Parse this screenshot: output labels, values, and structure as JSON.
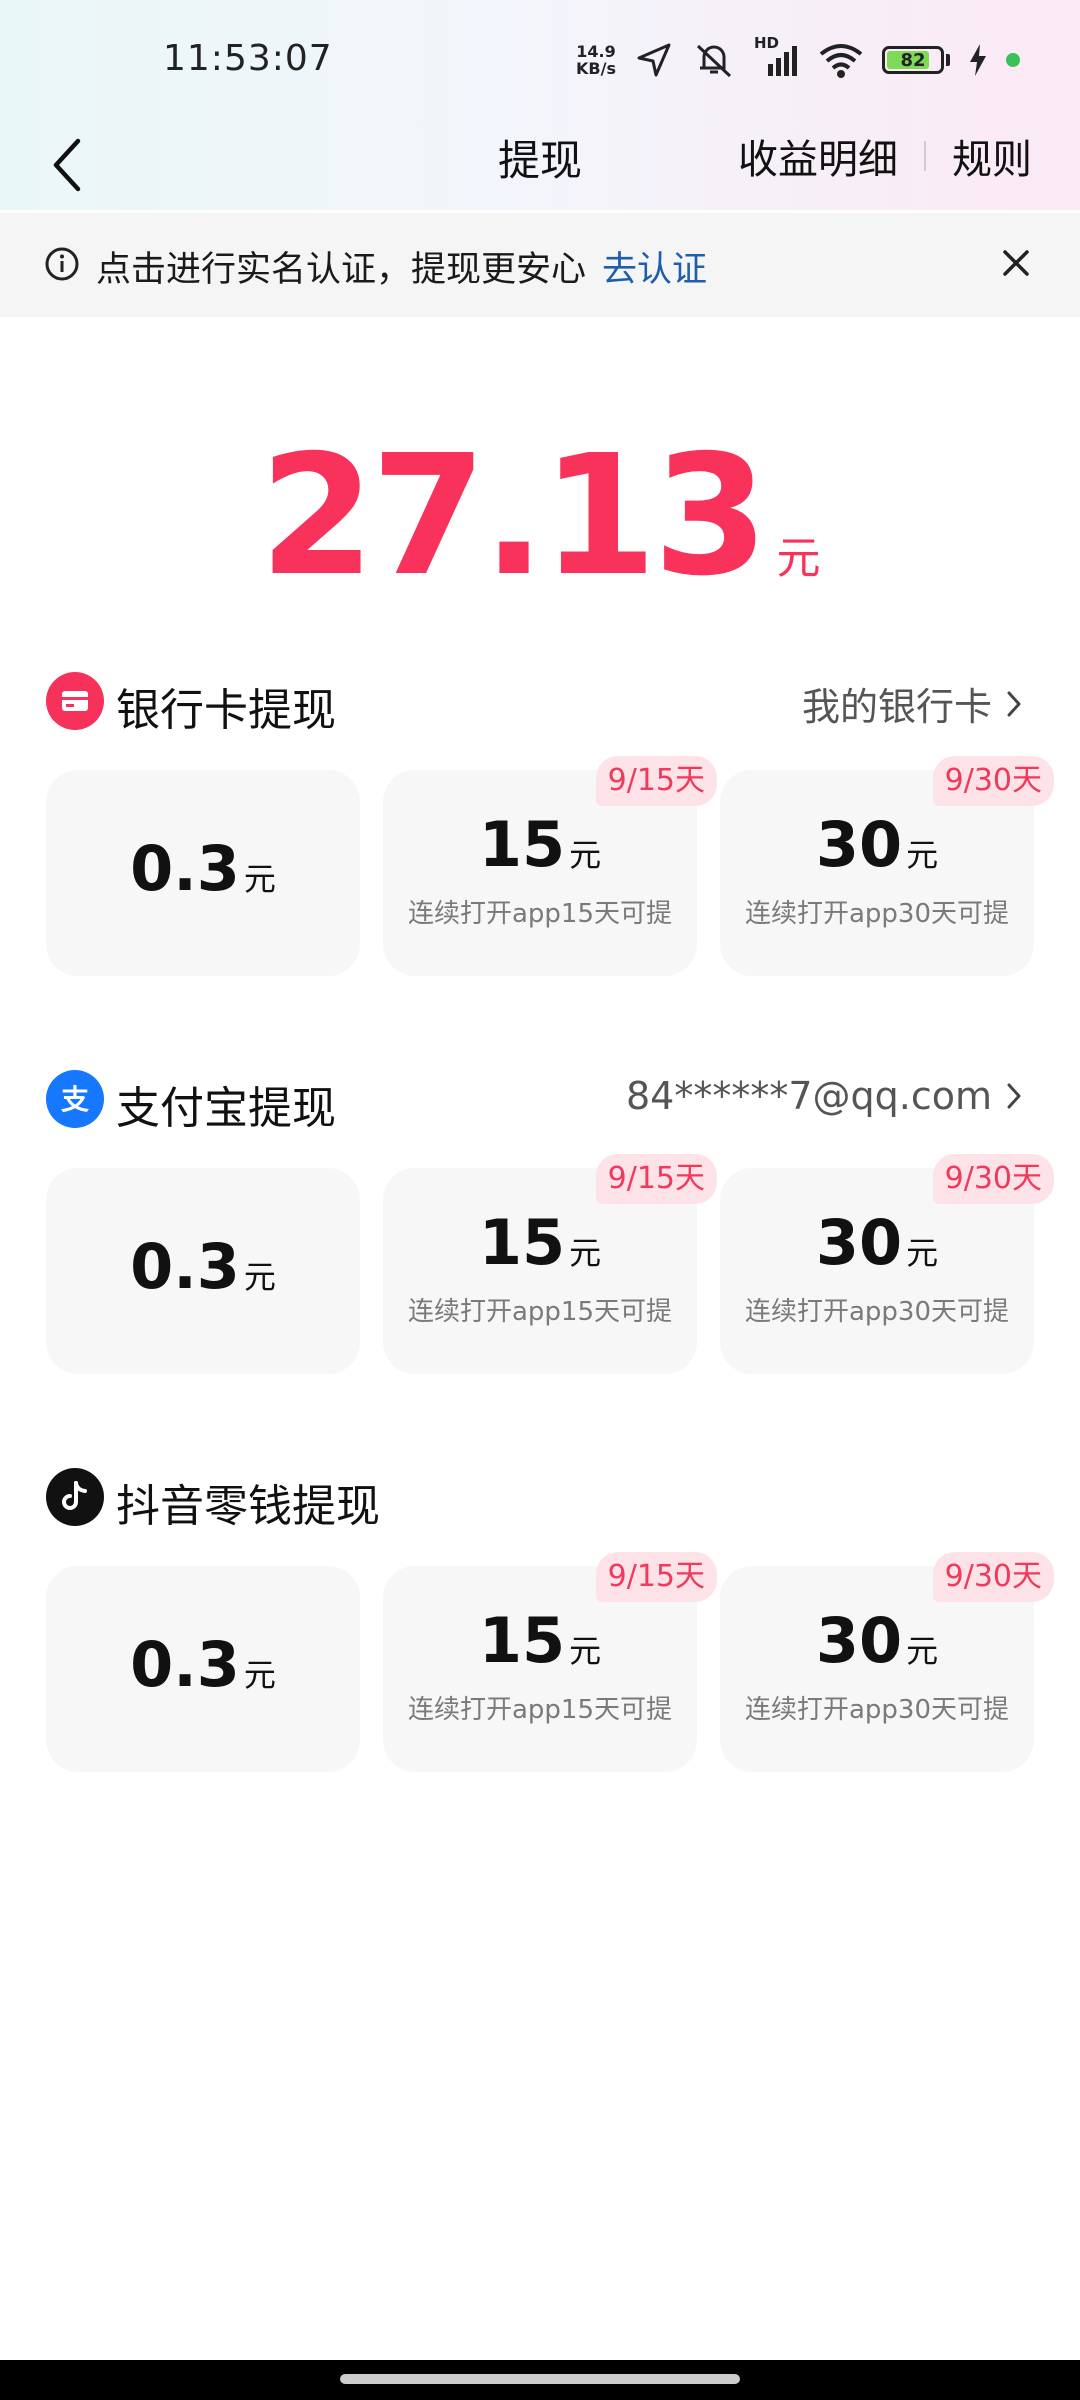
{
  "status_bar": {
    "time": "11:53:07",
    "net_speed_value": "14.9",
    "net_speed_unit": "KB/s",
    "network_label": "HD",
    "battery_level": "82",
    "icons": [
      "location-icon",
      "mute-icon",
      "signal-icon",
      "wifi-icon",
      "battery-icon",
      "charging-icon"
    ]
  },
  "nav": {
    "title": "提现",
    "earnings_detail": "收益明细",
    "rules": "规则"
  },
  "notice": {
    "text": "点击进行实名认证，提现更安心",
    "link": "去认证"
  },
  "balance": {
    "amount": "27.13",
    "unit": "元"
  },
  "sections": [
    {
      "title": "银行卡提现",
      "right_text": "我的银行卡",
      "icon": "bank-card-icon",
      "icon_color": "#f7325a",
      "options": [
        {
          "value": "0.3",
          "unit": "元",
          "note": "",
          "badge": ""
        },
        {
          "value": "15",
          "unit": "元",
          "note": "连续打开app15天可提",
          "badge": "9/15天"
        },
        {
          "value": "30",
          "unit": "元",
          "note": "连续打开app30天可提",
          "badge": "9/30天"
        }
      ]
    },
    {
      "title": "支付宝提现",
      "right_text": "84******7@qq.com",
      "icon": "alipay-icon",
      "icon_color": "#1677ff",
      "options": [
        {
          "value": "0.3",
          "unit": "元",
          "note": "",
          "badge": ""
        },
        {
          "value": "15",
          "unit": "元",
          "note": "连续打开app15天可提",
          "badge": "9/15天"
        },
        {
          "value": "30",
          "unit": "元",
          "note": "连续打开app30天可提",
          "badge": "9/30天"
        }
      ]
    },
    {
      "title": "抖音零钱提现",
      "right_text": "",
      "icon": "douyin-icon",
      "icon_color": "#111111",
      "options": [
        {
          "value": "0.3",
          "unit": "元",
          "note": "",
          "badge": ""
        },
        {
          "value": "15",
          "unit": "元",
          "note": "连续打开app15天可提",
          "badge": "9/15天"
        },
        {
          "value": "30",
          "unit": "元",
          "note": "连续打开app30天可提",
          "badge": "9/30天"
        }
      ]
    }
  ]
}
